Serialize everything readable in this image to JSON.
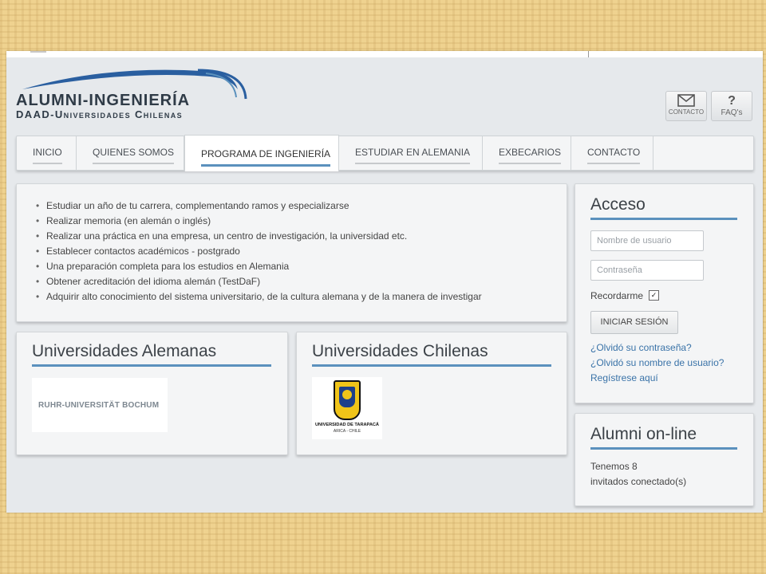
{
  "brand": {
    "line1": "ALUMNI-INGENIERÍA",
    "line2": "DAAD-Universidades Chilenas"
  },
  "top_buttons": {
    "contacto": {
      "label": "CONTACTO",
      "icon": "envelope-icon"
    },
    "faq": {
      "label": "FAQ's",
      "icon": "question-icon",
      "glyph": "?"
    }
  },
  "nav": {
    "items": [
      {
        "label": "INICIO"
      },
      {
        "label": "QUIENES SOMOS"
      },
      {
        "label": "PROGRAMA DE INGENIERÍA",
        "active": true
      },
      {
        "label": "ESTUDIAR EN ALEMANIA"
      },
      {
        "label": "EXBECARIOS"
      },
      {
        "label": "CONTACTO"
      }
    ]
  },
  "benefits": [
    "Estudiar un año de tu carrera, complementando ramos y especializarse",
    "Realizar memoria (en alemán o inglés)",
    "Realizar una práctica en una empresa, un centro de investigación, la universidad etc.",
    "Establecer contactos académicos - postgrado",
    "Una preparación completa para los estudios en Alemania",
    "Obtener acreditación del idioma alemán (TestDaF)",
    "Adquirir alto conocimiento del sistema universitario, de la cultura alemana y de la manera de investigar"
  ],
  "uni_de": {
    "title": "Universidades Alemanas",
    "logo_text": "RUHR-UNIVERSITÄT BOCHUM"
  },
  "uni_cl": {
    "title": "Universidades Chilenas",
    "logo_name": "UNIVERSIDAD DE TARAPACÁ",
    "logo_city": "ARICA - CHILE"
  },
  "login": {
    "title": "Acceso",
    "username_placeholder": "Nombre de usuario",
    "password_placeholder": "Contraseña",
    "remember_label": "Recordarme",
    "remember_checked": true,
    "submit_label": "INICIAR SESIÓN",
    "forgot_password": "¿Olvidó su contraseña?",
    "forgot_username": "¿Olvidó su nombre de usuario?",
    "register": "Regístrese aquí"
  },
  "online": {
    "title": "Alumni on-line",
    "line1": "Tenemos 8",
    "line2": "invitados conectado(s)"
  },
  "colors": {
    "accent": "#5b91bd",
    "link": "#3a73a8",
    "logo_swoosh": "#2a5fa0"
  }
}
